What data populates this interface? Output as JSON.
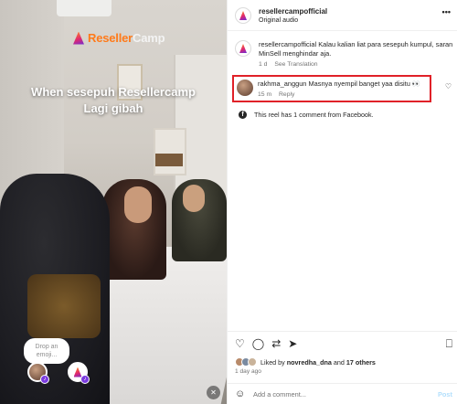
{
  "video": {
    "brand_part1": "Reseller",
    "brand_part2": "Camp",
    "caption_line1": "When sesepuh Resellercamp",
    "caption_line2": "Lagi gibah",
    "drop_emoji_line1": "Drop an",
    "drop_emoji_line2": "emoji...",
    "mute_icon": "speaker-muted"
  },
  "header": {
    "username": "resellercampofficial",
    "audio": "Original audio",
    "more": "•••"
  },
  "caption": {
    "username": "resellercampofficial",
    "text": "Kalau kalian liat para sesepuh kumpul, saran MinSell menghindar aja.",
    "time": "1 d",
    "see_translation": "See Translation"
  },
  "comment": {
    "username": "rakhma_anggun",
    "text": "Masnya nyempil banget yaa disitu",
    "emoji": "👀",
    "time": "15 m",
    "reply": "Reply",
    "highlight_color": "#e02128"
  },
  "facebook_note": "This reel has 1 comment from Facebook.",
  "actions": {
    "liked_by_prefix": "Liked by",
    "liked_by_user": "novredha_dna",
    "liked_by_and": "and",
    "liked_by_others": "17 others",
    "ago": "1 day ago",
    "add_comment_placeholder": "Add a comment...",
    "post": "Post"
  }
}
